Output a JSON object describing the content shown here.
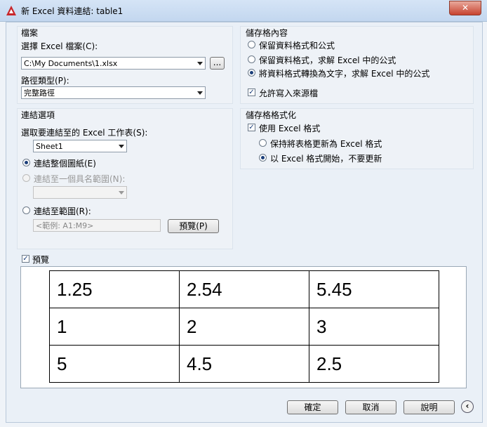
{
  "window": {
    "title": "新 Excel 資料連結: table1",
    "close_label": "✕"
  },
  "file_group": {
    "title": "檔案",
    "select_label": "選擇 Excel 檔案(C):",
    "file_value": "C:\\My Documents\\1.xlsx",
    "browse_label": "...",
    "path_type_label": "路徑類型(P):",
    "path_type_value": "完整路徑"
  },
  "cell_content_group": {
    "title": "儲存格內容",
    "options": [
      "保留資料格式和公式",
      "保留資料格式，求解 Excel 中的公式",
      "將資料格式轉換為文字，求解 Excel 中的公式"
    ],
    "selected_index": 2,
    "allow_writeback_label": "允許寫入來源檔"
  },
  "link_group": {
    "title": "連結選項",
    "sheet_label": "選取要連結至的 Excel 工作表(S):",
    "sheet_value": "Sheet1",
    "opt_entire_sheet": "連結整個圖紙(E)",
    "opt_named_range": "連結至一個具名範圍(N):",
    "opt_range": "連結至範圍(R):",
    "range_placeholder": "<範例: A1:M9>",
    "preview_button": "預覽(P)"
  },
  "format_group": {
    "title": "儲存格格式化",
    "use_excel_format": "使用 Excel 格式",
    "opt_keep_updated": "保持將表格更新為 Excel 格式",
    "opt_start_no_update": "以 Excel 格式開始，不要更新"
  },
  "preview": {
    "label": "預覽",
    "rows": [
      [
        "1.25",
        "2.54",
        "5.45"
      ],
      [
        "1",
        "2",
        "3"
      ],
      [
        "5",
        "4.5",
        "2.5"
      ]
    ]
  },
  "footer": {
    "ok": "確定",
    "cancel": "取消",
    "help": "說明",
    "collapse_icon": "chevron-left-icon"
  }
}
